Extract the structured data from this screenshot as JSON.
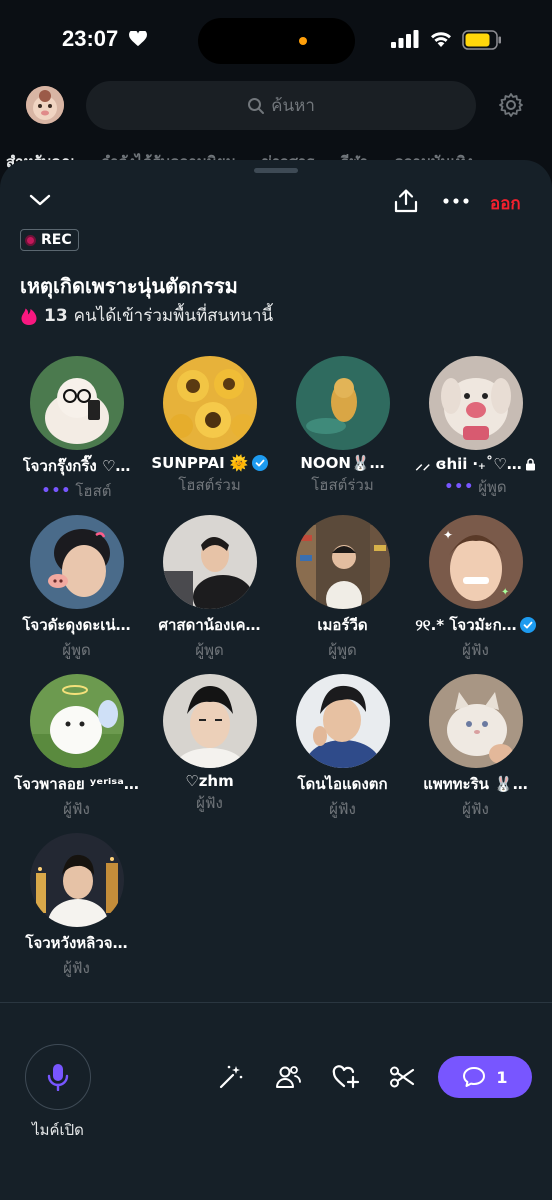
{
  "status_bar": {
    "time": "23:07"
  },
  "background": {
    "search_placeholder": "ค้นหา",
    "tabs": [
      "สำหรับคุณ",
      "กำลังได้รับความนิยม",
      "ข่าวสาร",
      "กีฬา",
      "ความบันเทิง"
    ]
  },
  "space": {
    "leave_label": "ออก",
    "rec_label": "REC",
    "title": "เหตุเกิดเพราะนุ่นตัดกรรม",
    "joined_count": "13",
    "joined_text": "คนได้เข้าร่วมพื้นที่สนทนานี้",
    "participants": [
      {
        "name": "โจวกรุ๊งกริ๊ง ♡…",
        "role": "โฮสต์",
        "speaking": true,
        "verified": false
      },
      {
        "name": "SUNPPAI 🌞",
        "role": "โฮสต์ร่วม",
        "speaking": false,
        "verified": true
      },
      {
        "name": "NOON🐰…",
        "role": "โฮสต์ร่วม",
        "speaking": false,
        "verified": false
      },
      {
        "name": "⸝⸝ ɞhii ‧₊˚♡…",
        "role": "ผู้พูด",
        "speaking": true,
        "verified": false,
        "locked": true
      },
      {
        "name": "โจวดัะดุงดะเน่…",
        "role": "ผู้พูด",
        "speaking": false,
        "verified": false
      },
      {
        "name": "ศาสดาน้องเค…",
        "role": "ผู้พูด",
        "speaking": false,
        "verified": false
      },
      {
        "name": "เมอร์วีด",
        "role": "ผู้พูด",
        "speaking": false,
        "verified": false
      },
      {
        "name": "୨୧.* โจวมัะก…",
        "role": "ผู้ฟัง",
        "speaking": false,
        "verified": true
      },
      {
        "name": "โจวพาลอย ʸᵉʳⁱˢᵃ…",
        "role": "ผู้ฟัง",
        "speaking": false,
        "verified": false
      },
      {
        "name": "♡zhm",
        "role": "ผู้ฟัง",
        "speaking": false,
        "verified": false
      },
      {
        "name": "โดนไอแดงตก",
        "role": "ผู้ฟัง",
        "speaking": false,
        "verified": false
      },
      {
        "name": "แพททะริน 🐰…",
        "role": "ผู้ฟัง",
        "speaking": false,
        "verified": false
      },
      {
        "name": "โจวหวังหลิวจ…",
        "role": "ผู้ฟัง",
        "speaking": false,
        "verified": false
      }
    ],
    "mic_label": "ไมค์เปิด",
    "chat_count": "1"
  },
  "colors": {
    "accent": "#7856ff",
    "leave": "#f4212e",
    "verified": "#1d9bf0",
    "sheet": "#162028"
  }
}
